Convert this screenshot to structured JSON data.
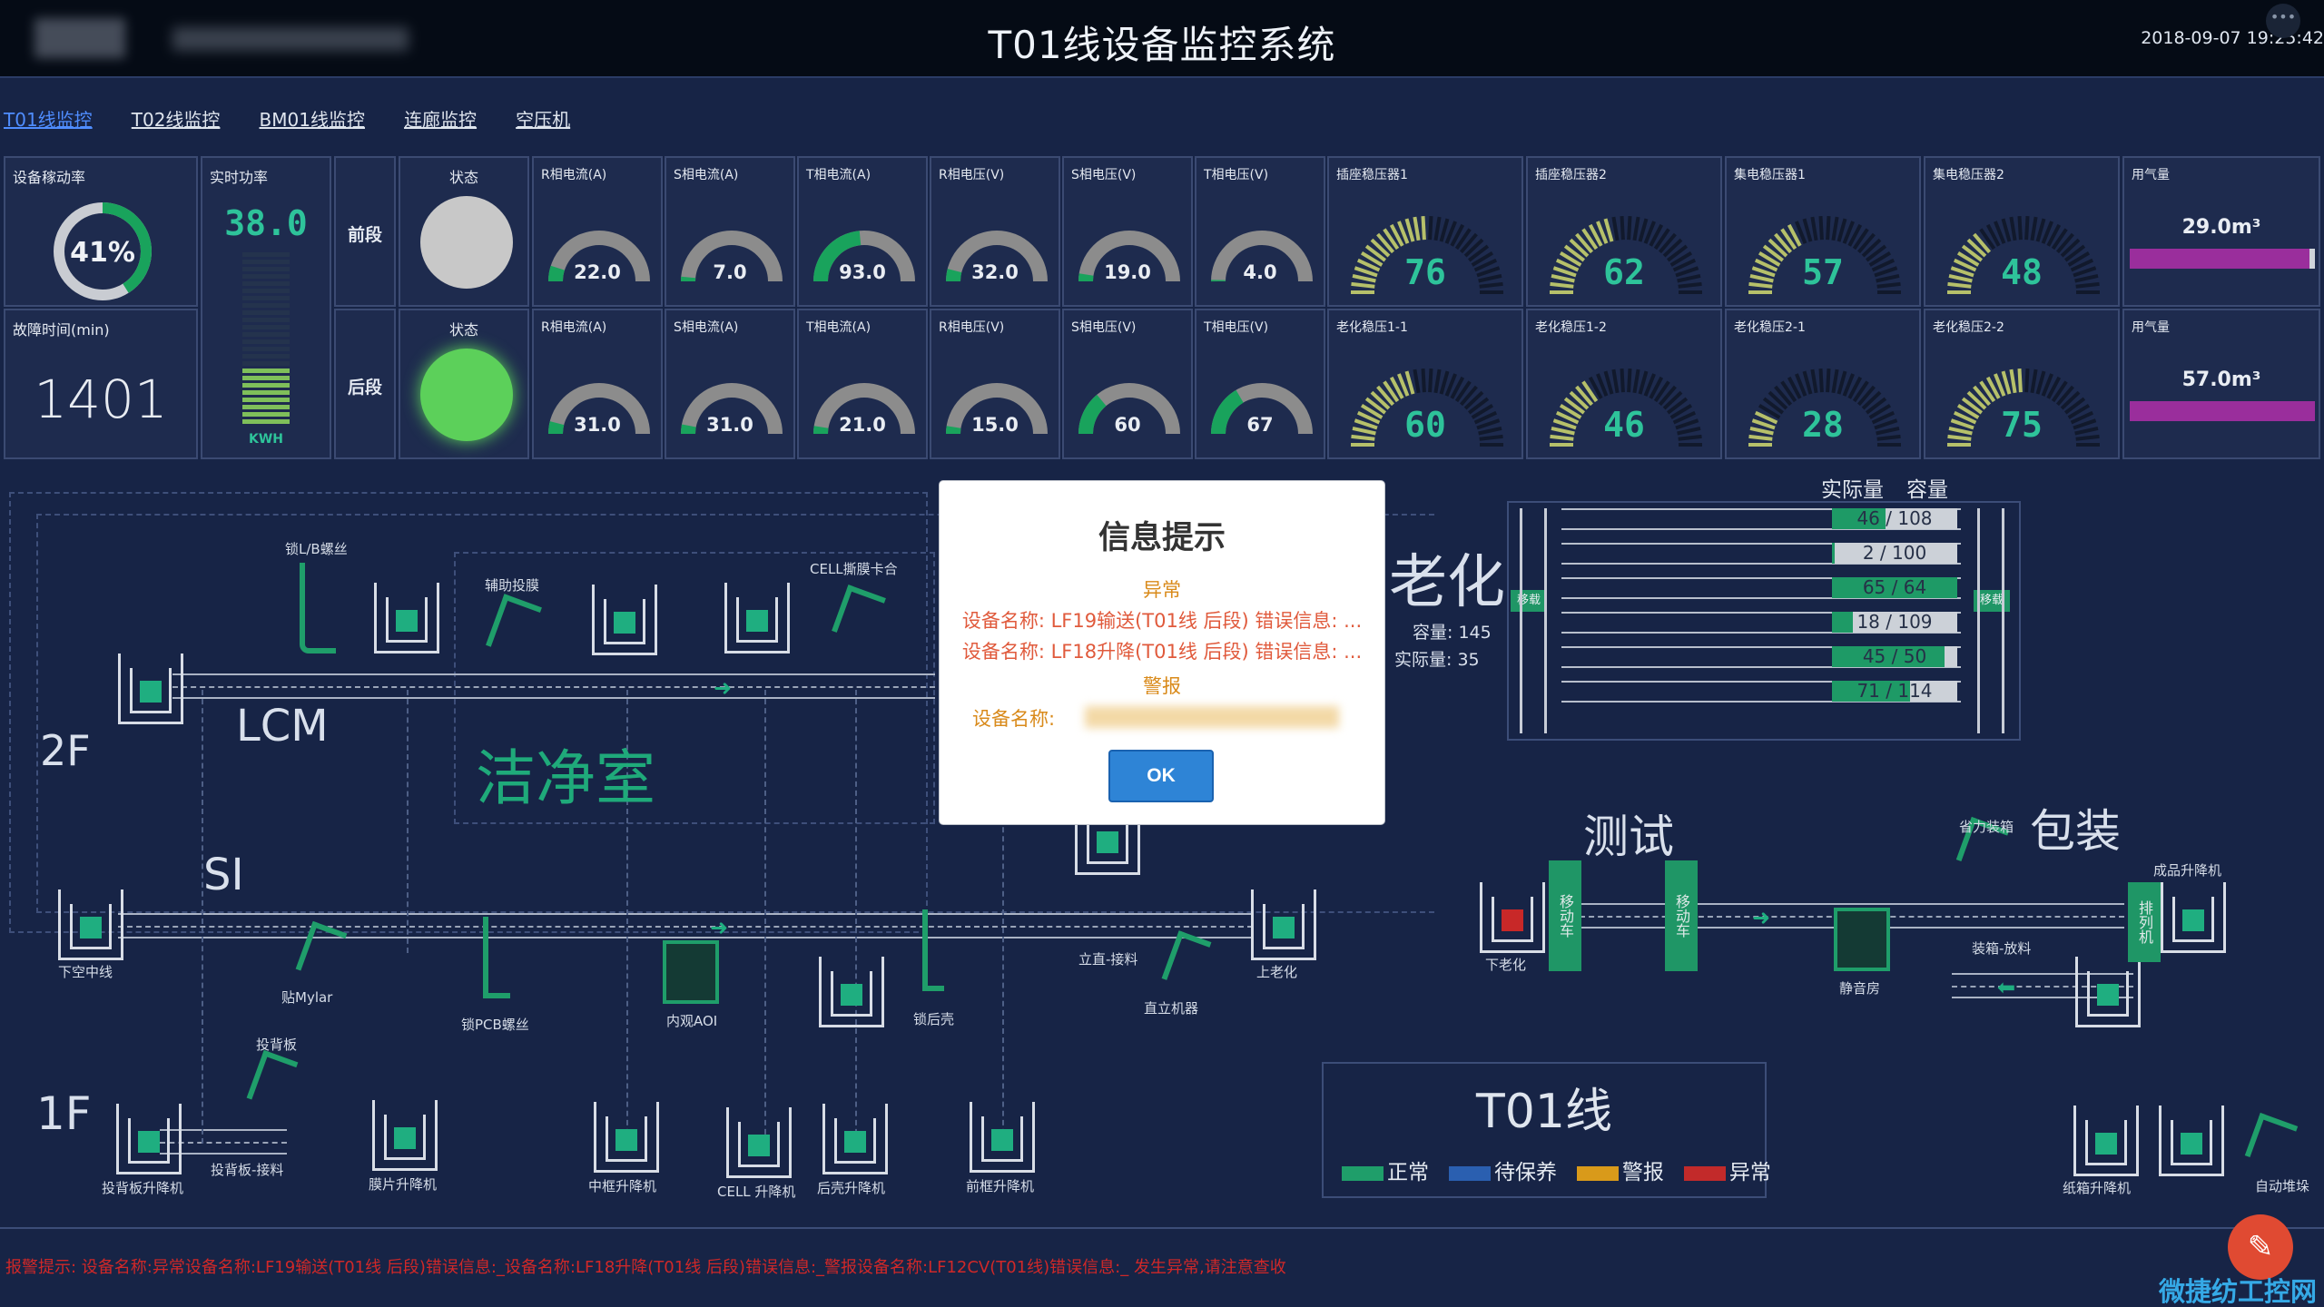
{
  "header": {
    "title": "T01线设备监控系统",
    "datetime": "2018-09-07 19:25:42"
  },
  "tabs": [
    {
      "label": "T01线监控",
      "active": true
    },
    {
      "label": "T02线监控",
      "active": false
    },
    {
      "label": "BM01线监控",
      "active": false
    },
    {
      "label": "连廊监控",
      "active": false
    },
    {
      "label": "空压机",
      "active": false
    }
  ],
  "kpis": {
    "utilization": {
      "label": "设备稼动率",
      "value": "41%",
      "fraction": 0.41
    },
    "downtime": {
      "label": "故障时间(min)",
      "value": "1401"
    },
    "power": {
      "label": "实时功率",
      "value": "38.0",
      "unit": "KWH",
      "level": 0.3
    }
  },
  "sections": [
    {
      "name": "前段",
      "status_label": "状态",
      "status_color": "#c8c8c8",
      "gauges": [
        {
          "label": "R相电流(A)",
          "value": "22.0",
          "fraction": 0.1
        },
        {
          "label": "S相电流(A)",
          "value": "7.0",
          "fraction": 0.03
        },
        {
          "label": "T相电流(A)",
          "value": "93.0",
          "fraction": 0.47
        },
        {
          "label": "R相电压(V)",
          "value": "32.0",
          "fraction": 0.08
        },
        {
          "label": "S相电压(V)",
          "value": "19.0",
          "fraction": 0.05
        },
        {
          "label": "T相电压(V)",
          "value": "4.0",
          "fraction": 0.01
        }
      ],
      "stabilizers": [
        {
          "label": "插座稳压器1",
          "value": "76",
          "fraction": 0.5
        },
        {
          "label": "插座稳压器2",
          "value": "62",
          "fraction": 0.42
        },
        {
          "label": "集电稳压器1",
          "value": "57",
          "fraction": 0.36
        },
        {
          "label": "集电稳压器2",
          "value": "48",
          "fraction": 0.3
        }
      ],
      "gas": {
        "label": "用气量",
        "value": "29.0m³",
        "fraction": 0.97
      }
    },
    {
      "name": "后段",
      "status_label": "状态",
      "status_color": "#5cd05a",
      "gauges": [
        {
          "label": "R相电流(A)",
          "value": "31.0",
          "fraction": 0.08
        },
        {
          "label": "S相电流(A)",
          "value": "31.0",
          "fraction": 0.06
        },
        {
          "label": "T相电流(A)",
          "value": "21.0",
          "fraction": 0.05
        },
        {
          "label": "R相电压(V)",
          "value": "15.0",
          "fraction": 0.05
        },
        {
          "label": "S相电压(V)",
          "value": "60",
          "fraction": 0.28
        },
        {
          "label": "T相电压(V)",
          "value": "67",
          "fraction": 0.33
        }
      ],
      "stabilizers": [
        {
          "label": "老化稳压1-1",
          "value": "60",
          "fraction": 0.42
        },
        {
          "label": "老化稳压1-2",
          "value": "46",
          "fraction": 0.32
        },
        {
          "label": "老化稳压2-1",
          "value": "28",
          "fraction": 0.15
        },
        {
          "label": "老化稳压2-2",
          "value": "75",
          "fraction": 0.5
        }
      ],
      "gas": {
        "label": "用气量",
        "value": "57.0m³",
        "fraction": 1.0
      }
    }
  ],
  "aging": {
    "title": "老化",
    "capacity_label": "容量:",
    "capacity": "145",
    "actual_label": "实际量:",
    "actual": "35",
    "col_actual": "实际量",
    "col_capacity": "容量",
    "side_label": "移载",
    "rows": [
      {
        "text": "46 / 108",
        "fraction": 0.43
      },
      {
        "text": "2 / 100",
        "fraction": 0.02
      },
      {
        "text": "65 / 64",
        "fraction": 1.0
      },
      {
        "text": "18 / 109",
        "fraction": 0.17
      },
      {
        "text": "45 / 50",
        "fraction": 0.9
      },
      {
        "text": "71 / 114",
        "fraction": 0.62
      }
    ]
  },
  "floor": {
    "floor_2f": "2F",
    "floor_1f": "1F",
    "lcm": "LCM",
    "si": "SI",
    "clean_room": "洁净室",
    "test": "测试",
    "pack": "包装",
    "cart_label": "移动车",
    "sort_label": "排列机",
    "labels": {
      "lock_lb": "锁L/B螺丝",
      "aux_film": "辅助投膜",
      "cell_tear": "CELL撕膜卡合",
      "lower_empty": "下空中线",
      "mylar": "贴Mylar",
      "lock_pcb": "锁PCB螺丝",
      "inner_aoi": "内观AOI",
      "lock_back": "锁后壳",
      "upright_pick": "立直-接料",
      "upright_machine": "直立机器",
      "up_aging": "上老化",
      "down_aging": "下老化",
      "backboard": "投背板",
      "backboard_pick": "投背板-接料",
      "backboard_lift": "投背板升降机",
      "film_lift": "膜片升降机",
      "midframe_lift": "中框升降机",
      "cell_lift": "CELL 升降机",
      "backshell_lift": "后壳升降机",
      "frontframe_lift": "前框升降机",
      "packing_pick": "装箱-放料",
      "silent_room": "静音房",
      "power_box": "省力装箱",
      "finished_lift": "成品升降机",
      "carton_lift": "纸箱升降机",
      "auto_stack": "自动堆垛"
    }
  },
  "legend": {
    "line_name": "T01线",
    "items": [
      {
        "label": "正常",
        "color": "#1f9e6a"
      },
      {
        "label": "待保养",
        "color": "#2a5fb0"
      },
      {
        "label": "警报",
        "color": "#d99a1a"
      },
      {
        "label": "异常",
        "color": "#c22a2a"
      }
    ]
  },
  "alarm_ticker": {
    "text": "报警提示:  设备名称:异常设备名称:LF19输送(T01线 后段)错误信息:_设备名称:LF18升降(T01线 后段)错误信息:_警报设备名称:LF12CV(T01线)错误信息:_ 发生异常,请注意查收"
  },
  "modal": {
    "title": "信息提示",
    "abnormal_heading": "异常",
    "abnormal_lines": [
      "设备名称: LF19输送(T01线 后段) 错误信息: ...",
      "设备名称: LF18升降(T01线 后段) 错误信息: ..."
    ],
    "alarm_heading": "警报",
    "alarm_line": "设备名称:",
    "ok_label": "OK"
  },
  "watermark": "微捷纺工控网",
  "colors": {
    "normal": "#1f9e6a",
    "gauge_track": "#8c8c8c",
    "stabilizer_fill": "#b6c06a",
    "gas_bar": "#9a2e9c"
  }
}
